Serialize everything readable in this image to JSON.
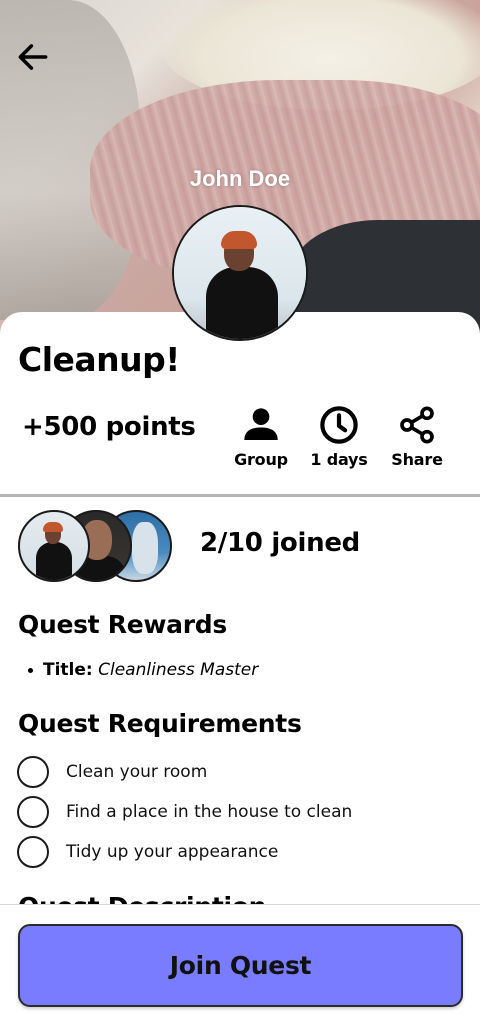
{
  "header": {
    "user_name": "John Doe",
    "back_icon": "arrow-left-icon"
  },
  "quest": {
    "title": "Cleanup!",
    "points": "+500 points",
    "stats": [
      {
        "icon": "user-icon",
        "label": "Group"
      },
      {
        "icon": "clock-icon",
        "label": "1 days"
      },
      {
        "icon": "share-icon",
        "label": "Share"
      }
    ],
    "joined": "2/10 joined"
  },
  "rewards": {
    "heading": "Quest Rewards",
    "items": [
      {
        "key": "Title:",
        "value": "Cleanliness Master"
      }
    ]
  },
  "requirements": {
    "heading": "Quest Requirements",
    "items": [
      "Clean your room",
      "Find a place in the house to clean",
      "Tidy up your appearance"
    ]
  },
  "description": {
    "heading": "Quest Description"
  },
  "footer": {
    "join_label": "Join Quest",
    "accent": "#7a7cff"
  }
}
